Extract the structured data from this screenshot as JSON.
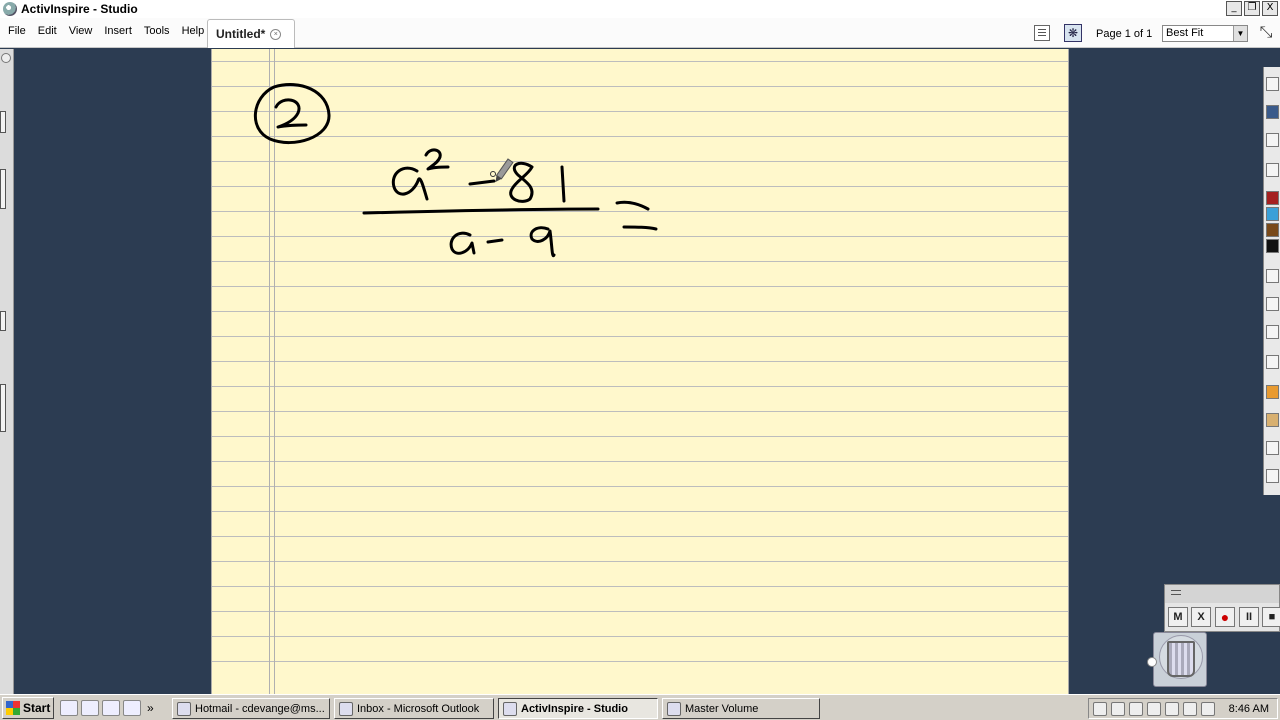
{
  "window": {
    "title": "ActivInspire - Studio",
    "controls": [
      "_",
      "❐",
      "X"
    ]
  },
  "menu": {
    "items": [
      "File",
      "Edit",
      "View",
      "Insert",
      "Tools",
      "Help"
    ]
  },
  "document": {
    "tab_label": "Untitled*"
  },
  "toolbar": {
    "page_label": "Page 1 of 1",
    "zoom_value": "Best Fit"
  },
  "recorder": {
    "buttons": [
      "M",
      "X",
      "●",
      "II",
      "■"
    ]
  },
  "taskbar": {
    "start_label": "Start",
    "tasks": [
      {
        "label": "Hotmail - cdevange@ms..."
      },
      {
        "label": "Inbox - Microsoft Outlook"
      },
      {
        "label": "ActivInspire - Studio",
        "active": true
      },
      {
        "label": "Master Volume"
      }
    ],
    "clock": "8:46 AM"
  },
  "colors": {
    "paper": "#fff8cc",
    "desktop": "#2c3c52",
    "ink": "#000000"
  }
}
